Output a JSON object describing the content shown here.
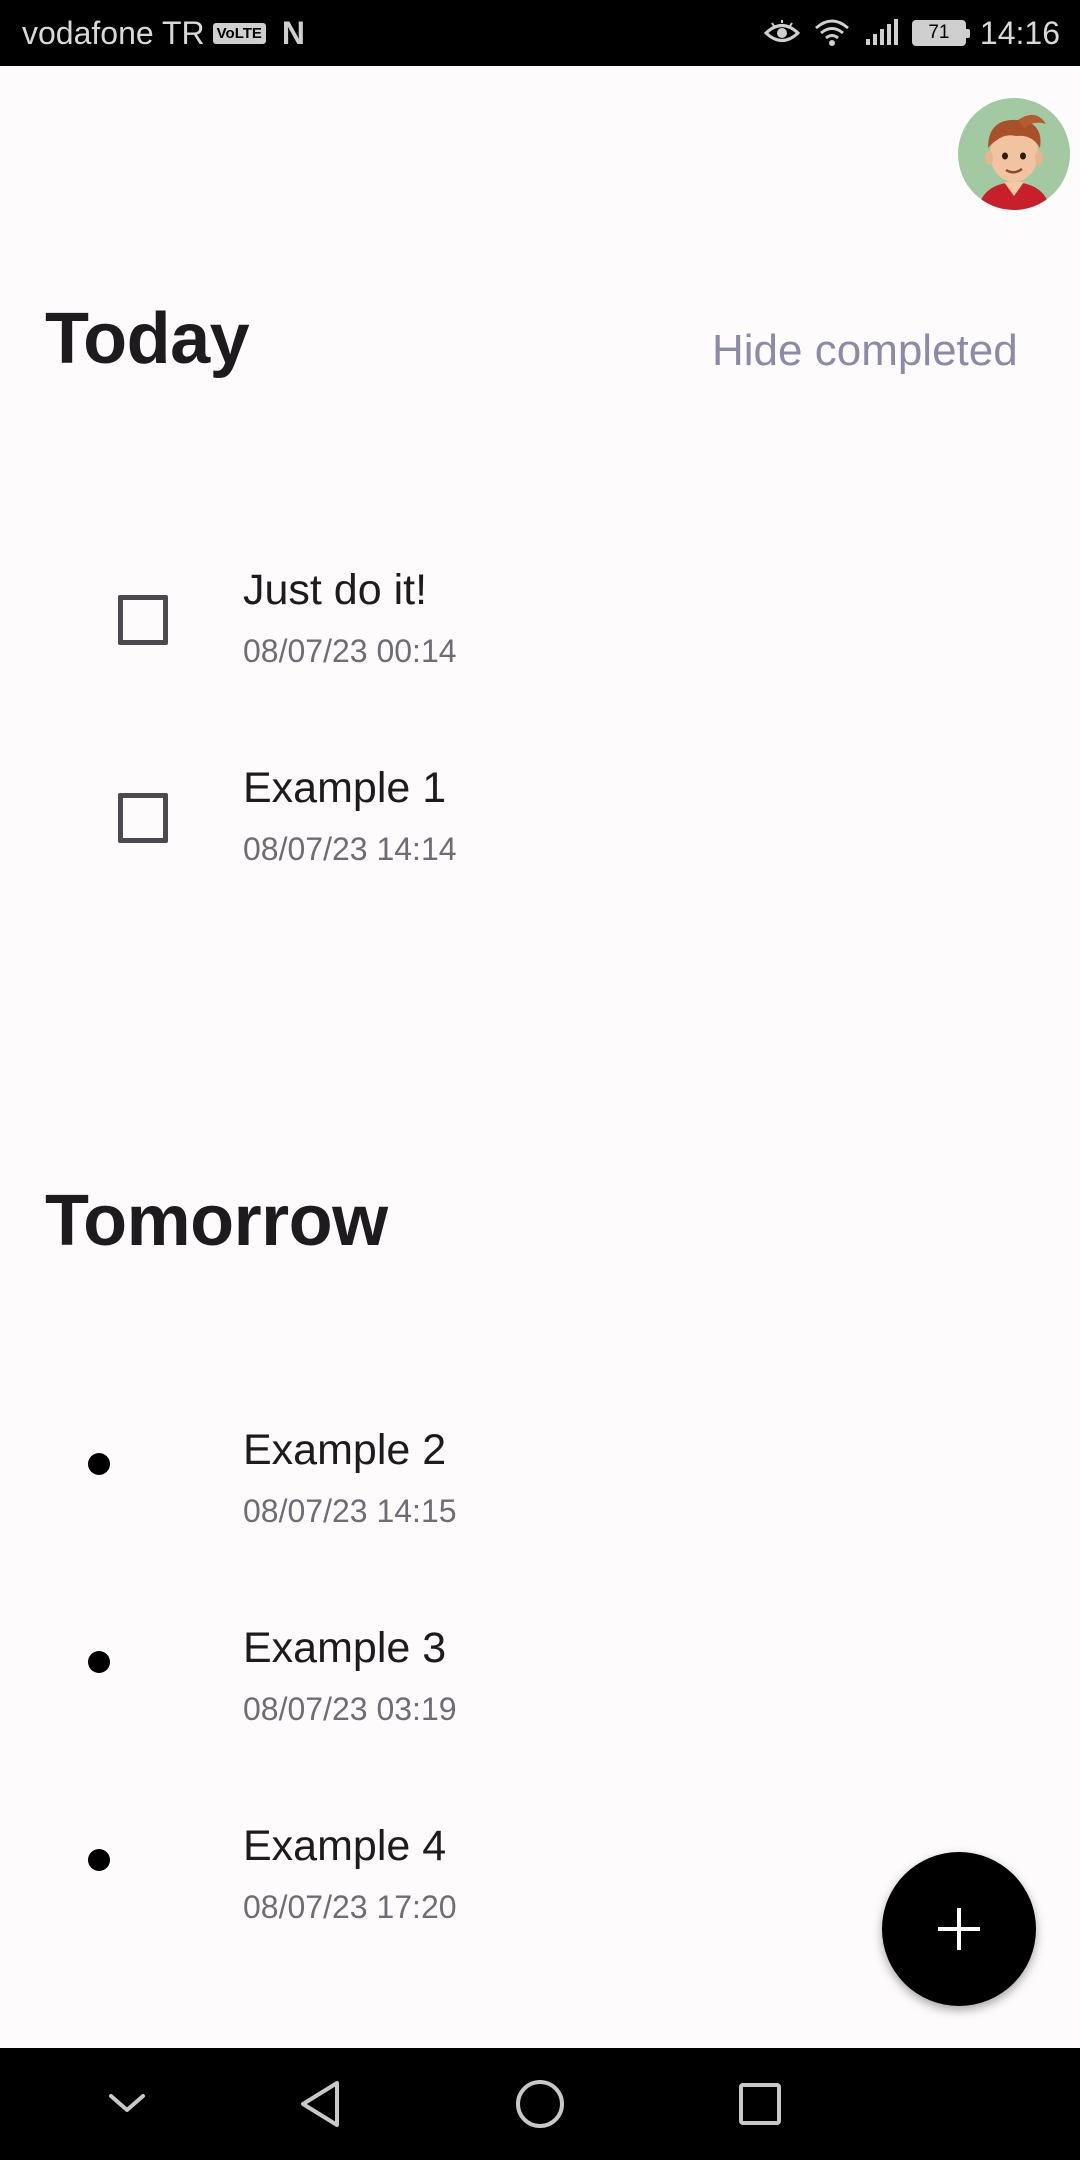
{
  "status_bar": {
    "carrier": "vodafone TR",
    "volte": "VoLTE",
    "notification_icon": "N",
    "battery_level": "71",
    "time": "14:16"
  },
  "header": {
    "avatar_icon": "user-avatar"
  },
  "today": {
    "title": "Today",
    "hide_completed": "Hide completed",
    "tasks": [
      {
        "title": "Just do it!",
        "date": "08/07/23 00:14",
        "checked": false
      },
      {
        "title": "Example 1",
        "date": "08/07/23 14:14",
        "checked": false
      }
    ]
  },
  "tomorrow": {
    "title": "Tomorrow",
    "tasks": [
      {
        "title": "Example 2",
        "date": "08/07/23 14:15"
      },
      {
        "title": "Example 3",
        "date": "08/07/23 03:19"
      },
      {
        "title": "Example 4",
        "date": "08/07/23 17:20"
      }
    ]
  },
  "fab": {
    "icon": "plus-icon"
  },
  "nav_bar": {
    "icons": [
      "chevron-down-icon",
      "back-icon",
      "home-icon",
      "recents-icon"
    ]
  },
  "colors": {
    "background": "#fdfbfc",
    "accent_text": "#8d8aa8",
    "fab": "#000000"
  }
}
